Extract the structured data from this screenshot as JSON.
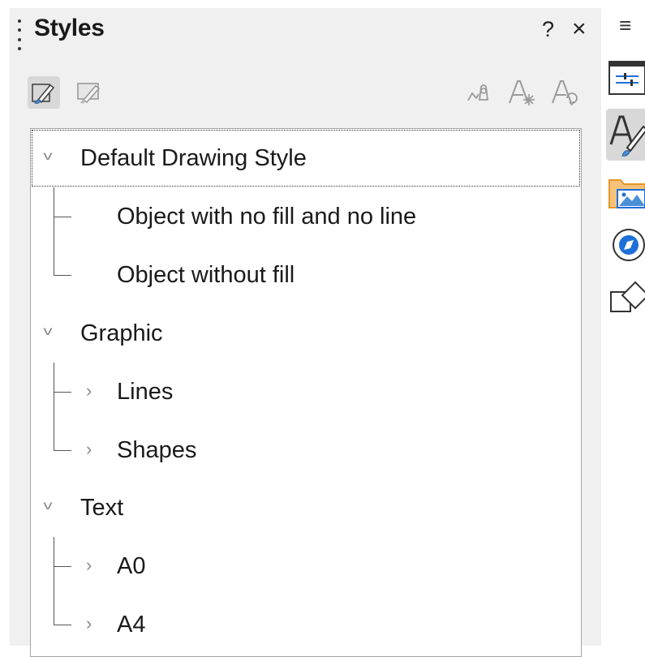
{
  "panel": {
    "title": "Styles",
    "help_label": "?",
    "close_label": "×"
  },
  "toolbar": {
    "buttons": [
      {
        "icon": "drawing-styles-icon",
        "active": true
      },
      {
        "icon": "presentation-styles-icon",
        "active": false
      },
      {
        "icon": "fill-format-mode-icon",
        "active": false
      },
      {
        "icon": "new-style-from-selection-icon",
        "active": false
      },
      {
        "icon": "update-style-icon",
        "active": false
      }
    ]
  },
  "tree": {
    "items": [
      {
        "label": "Default Drawing Style",
        "level": 0,
        "expanded": true,
        "selected": true
      },
      {
        "label": "Object with no fill and no line",
        "level": 1,
        "has_children": false
      },
      {
        "label": "Object without fill",
        "level": 1,
        "has_children": false
      },
      {
        "label": "Graphic",
        "level": 0,
        "expanded": true
      },
      {
        "label": "Lines",
        "level": 1,
        "has_children": true
      },
      {
        "label": "Shapes",
        "level": 1,
        "has_children": true
      },
      {
        "label": "Text",
        "level": 0,
        "expanded": true
      },
      {
        "label": "A0",
        "level": 1,
        "has_children": true
      },
      {
        "label": "A4",
        "level": 1,
        "has_children": true
      }
    ]
  },
  "sidebar": {
    "menu_label": "≡",
    "buttons": [
      {
        "icon": "properties-icon"
      },
      {
        "icon": "styles-icon",
        "active": true
      },
      {
        "icon": "gallery-icon"
      },
      {
        "icon": "navigator-icon"
      },
      {
        "icon": "shapes-icon"
      }
    ]
  },
  "colors": {
    "panel_bg": "#f0f0f0",
    "selected_button": "#d8d8d8",
    "gallery_orange": "#e8952a",
    "navigator_blue": "#1e6fd9",
    "accent_blue": "#4a90d9"
  }
}
